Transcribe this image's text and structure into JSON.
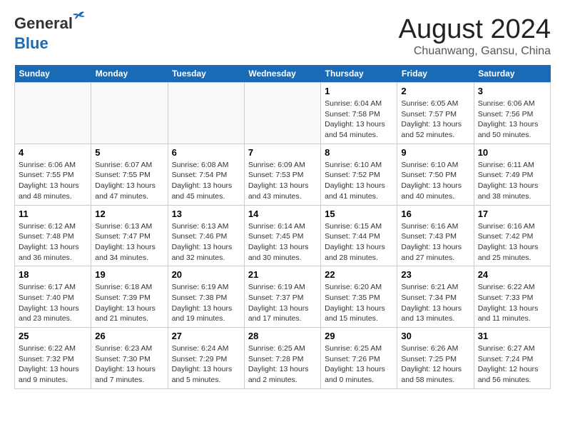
{
  "logo": {
    "line1": "General",
    "line2": "Blue"
  },
  "title": {
    "month_year": "August 2024",
    "location": "Chuanwang, Gansu, China"
  },
  "weekdays": [
    "Sunday",
    "Monday",
    "Tuesday",
    "Wednesday",
    "Thursday",
    "Friday",
    "Saturday"
  ],
  "weeks": [
    [
      {
        "day": "",
        "info": ""
      },
      {
        "day": "",
        "info": ""
      },
      {
        "day": "",
        "info": ""
      },
      {
        "day": "",
        "info": ""
      },
      {
        "day": "1",
        "info": "Sunrise: 6:04 AM\nSunset: 7:58 PM\nDaylight: 13 hours\nand 54 minutes."
      },
      {
        "day": "2",
        "info": "Sunrise: 6:05 AM\nSunset: 7:57 PM\nDaylight: 13 hours\nand 52 minutes."
      },
      {
        "day": "3",
        "info": "Sunrise: 6:06 AM\nSunset: 7:56 PM\nDaylight: 13 hours\nand 50 minutes."
      }
    ],
    [
      {
        "day": "4",
        "info": "Sunrise: 6:06 AM\nSunset: 7:55 PM\nDaylight: 13 hours\nand 48 minutes."
      },
      {
        "day": "5",
        "info": "Sunrise: 6:07 AM\nSunset: 7:55 PM\nDaylight: 13 hours\nand 47 minutes."
      },
      {
        "day": "6",
        "info": "Sunrise: 6:08 AM\nSunset: 7:54 PM\nDaylight: 13 hours\nand 45 minutes."
      },
      {
        "day": "7",
        "info": "Sunrise: 6:09 AM\nSunset: 7:53 PM\nDaylight: 13 hours\nand 43 minutes."
      },
      {
        "day": "8",
        "info": "Sunrise: 6:10 AM\nSunset: 7:52 PM\nDaylight: 13 hours\nand 41 minutes."
      },
      {
        "day": "9",
        "info": "Sunrise: 6:10 AM\nSunset: 7:50 PM\nDaylight: 13 hours\nand 40 minutes."
      },
      {
        "day": "10",
        "info": "Sunrise: 6:11 AM\nSunset: 7:49 PM\nDaylight: 13 hours\nand 38 minutes."
      }
    ],
    [
      {
        "day": "11",
        "info": "Sunrise: 6:12 AM\nSunset: 7:48 PM\nDaylight: 13 hours\nand 36 minutes."
      },
      {
        "day": "12",
        "info": "Sunrise: 6:13 AM\nSunset: 7:47 PM\nDaylight: 13 hours\nand 34 minutes."
      },
      {
        "day": "13",
        "info": "Sunrise: 6:13 AM\nSunset: 7:46 PM\nDaylight: 13 hours\nand 32 minutes."
      },
      {
        "day": "14",
        "info": "Sunrise: 6:14 AM\nSunset: 7:45 PM\nDaylight: 13 hours\nand 30 minutes."
      },
      {
        "day": "15",
        "info": "Sunrise: 6:15 AM\nSunset: 7:44 PM\nDaylight: 13 hours\nand 28 minutes."
      },
      {
        "day": "16",
        "info": "Sunrise: 6:16 AM\nSunset: 7:43 PM\nDaylight: 13 hours\nand 27 minutes."
      },
      {
        "day": "17",
        "info": "Sunrise: 6:16 AM\nSunset: 7:42 PM\nDaylight: 13 hours\nand 25 minutes."
      }
    ],
    [
      {
        "day": "18",
        "info": "Sunrise: 6:17 AM\nSunset: 7:40 PM\nDaylight: 13 hours\nand 23 minutes."
      },
      {
        "day": "19",
        "info": "Sunrise: 6:18 AM\nSunset: 7:39 PM\nDaylight: 13 hours\nand 21 minutes."
      },
      {
        "day": "20",
        "info": "Sunrise: 6:19 AM\nSunset: 7:38 PM\nDaylight: 13 hours\nand 19 minutes."
      },
      {
        "day": "21",
        "info": "Sunrise: 6:19 AM\nSunset: 7:37 PM\nDaylight: 13 hours\nand 17 minutes."
      },
      {
        "day": "22",
        "info": "Sunrise: 6:20 AM\nSunset: 7:35 PM\nDaylight: 13 hours\nand 15 minutes."
      },
      {
        "day": "23",
        "info": "Sunrise: 6:21 AM\nSunset: 7:34 PM\nDaylight: 13 hours\nand 13 minutes."
      },
      {
        "day": "24",
        "info": "Sunrise: 6:22 AM\nSunset: 7:33 PM\nDaylight: 13 hours\nand 11 minutes."
      }
    ],
    [
      {
        "day": "25",
        "info": "Sunrise: 6:22 AM\nSunset: 7:32 PM\nDaylight: 13 hours\nand 9 minutes."
      },
      {
        "day": "26",
        "info": "Sunrise: 6:23 AM\nSunset: 7:30 PM\nDaylight: 13 hours\nand 7 minutes."
      },
      {
        "day": "27",
        "info": "Sunrise: 6:24 AM\nSunset: 7:29 PM\nDaylight: 13 hours\nand 5 minutes."
      },
      {
        "day": "28",
        "info": "Sunrise: 6:25 AM\nSunset: 7:28 PM\nDaylight: 13 hours\nand 2 minutes."
      },
      {
        "day": "29",
        "info": "Sunrise: 6:25 AM\nSunset: 7:26 PM\nDaylight: 13 hours\nand 0 minutes."
      },
      {
        "day": "30",
        "info": "Sunrise: 6:26 AM\nSunset: 7:25 PM\nDaylight: 12 hours\nand 58 minutes."
      },
      {
        "day": "31",
        "info": "Sunrise: 6:27 AM\nSunset: 7:24 PM\nDaylight: 12 hours\nand 56 minutes."
      }
    ]
  ]
}
